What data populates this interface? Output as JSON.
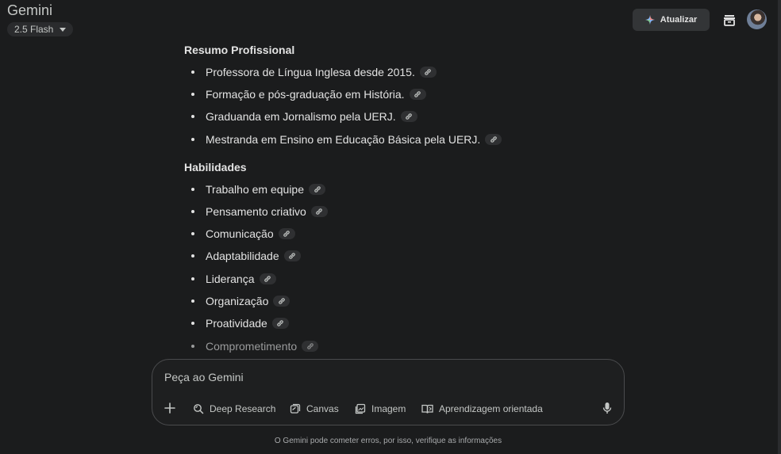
{
  "app": {
    "title": "Gemini",
    "model": "2.5 Flash",
    "update_label": "Atualizar"
  },
  "content": {
    "sections": [
      {
        "heading": "Resumo Profissional",
        "items": [
          "Professora de Língua Inglesa desde 2015.",
          "Formação e pós-graduação em História.",
          "Graduanda em Jornalismo pela UERJ.",
          "Mestranda em Ensino em Educação Básica pela UERJ."
        ]
      },
      {
        "heading": "Habilidades",
        "items": [
          "Trabalho em equipe",
          "Pensamento criativo",
          "Comunicação",
          "Adaptabilidade",
          "Liderança",
          "Organização",
          "Proatividade",
          "Comprometimento"
        ]
      }
    ]
  },
  "prompt": {
    "placeholder": "Peça ao Gemini",
    "tools": [
      "Deep Research",
      "Canvas",
      "Imagem",
      "Aprendizagem orientada"
    ]
  },
  "footer": {
    "disclaimer": "O Gemini pode cometer erros, por isso, verifique as informações"
  },
  "colors": {
    "background": "#1b1c1d",
    "text": "#e3e3e3",
    "muted": "#c4c7c5"
  },
  "icons": [
    "caret-down-icon",
    "sparkle-icon",
    "history-icon",
    "link-icon",
    "plus-icon",
    "deep-research-icon",
    "canvas-icon",
    "image-icon",
    "guided-learning-icon",
    "mic-icon"
  ]
}
